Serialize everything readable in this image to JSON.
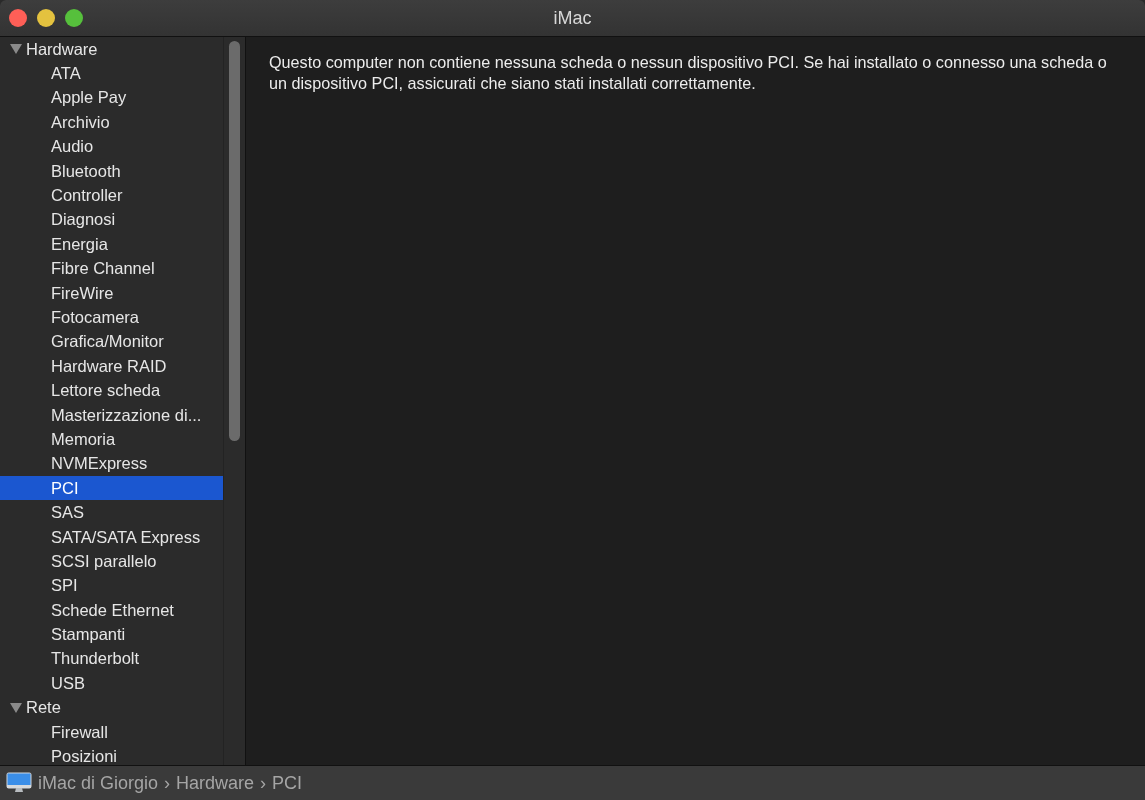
{
  "window": {
    "title": "iMac"
  },
  "sidebar": {
    "items": [
      {
        "label": "Hardware",
        "expanded": true,
        "selected": false,
        "children": [
          {
            "label": "ATA",
            "selected": false
          },
          {
            "label": "Apple Pay",
            "selected": false
          },
          {
            "label": "Archivio",
            "selected": false
          },
          {
            "label": "Audio",
            "selected": false
          },
          {
            "label": "Bluetooth",
            "selected": false
          },
          {
            "label": "Controller",
            "selected": false
          },
          {
            "label": "Diagnosi",
            "selected": false
          },
          {
            "label": "Energia",
            "selected": false
          },
          {
            "label": "Fibre Channel",
            "selected": false
          },
          {
            "label": "FireWire",
            "selected": false
          },
          {
            "label": "Fotocamera",
            "selected": false
          },
          {
            "label": "Grafica/Monitor",
            "selected": false
          },
          {
            "label": "Hardware RAID",
            "selected": false
          },
          {
            "label": "Lettore scheda",
            "selected": false
          },
          {
            "label": "Masterizzazione di...",
            "selected": false
          },
          {
            "label": "Memoria",
            "selected": false
          },
          {
            "label": "NVMExpress",
            "selected": false
          },
          {
            "label": "PCI",
            "selected": true
          },
          {
            "label": "SAS",
            "selected": false
          },
          {
            "label": "SATA/SATA Express",
            "selected": false
          },
          {
            "label": "SCSI parallelo",
            "selected": false
          },
          {
            "label": "SPI",
            "selected": false
          },
          {
            "label": "Schede Ethernet",
            "selected": false
          },
          {
            "label": "Stampanti",
            "selected": false
          },
          {
            "label": "Thunderbolt",
            "selected": false
          },
          {
            "label": "USB",
            "selected": false
          }
        ]
      },
      {
        "label": "Rete",
        "expanded": true,
        "selected": false,
        "children": [
          {
            "label": "Firewall",
            "selected": false
          },
          {
            "label": "Posizioni",
            "selected": false
          }
        ]
      }
    ]
  },
  "content": {
    "message": "Questo computer non contiene nessuna scheda o nessun dispositivo PCI. Se hai installato o connesso una scheda o un dispositivo PCI, assicurati che siano stati installati correttamente."
  },
  "status_bar": {
    "path": [
      "iMac di Giorgio",
      "Hardware",
      "PCI"
    ],
    "separator": "›"
  }
}
